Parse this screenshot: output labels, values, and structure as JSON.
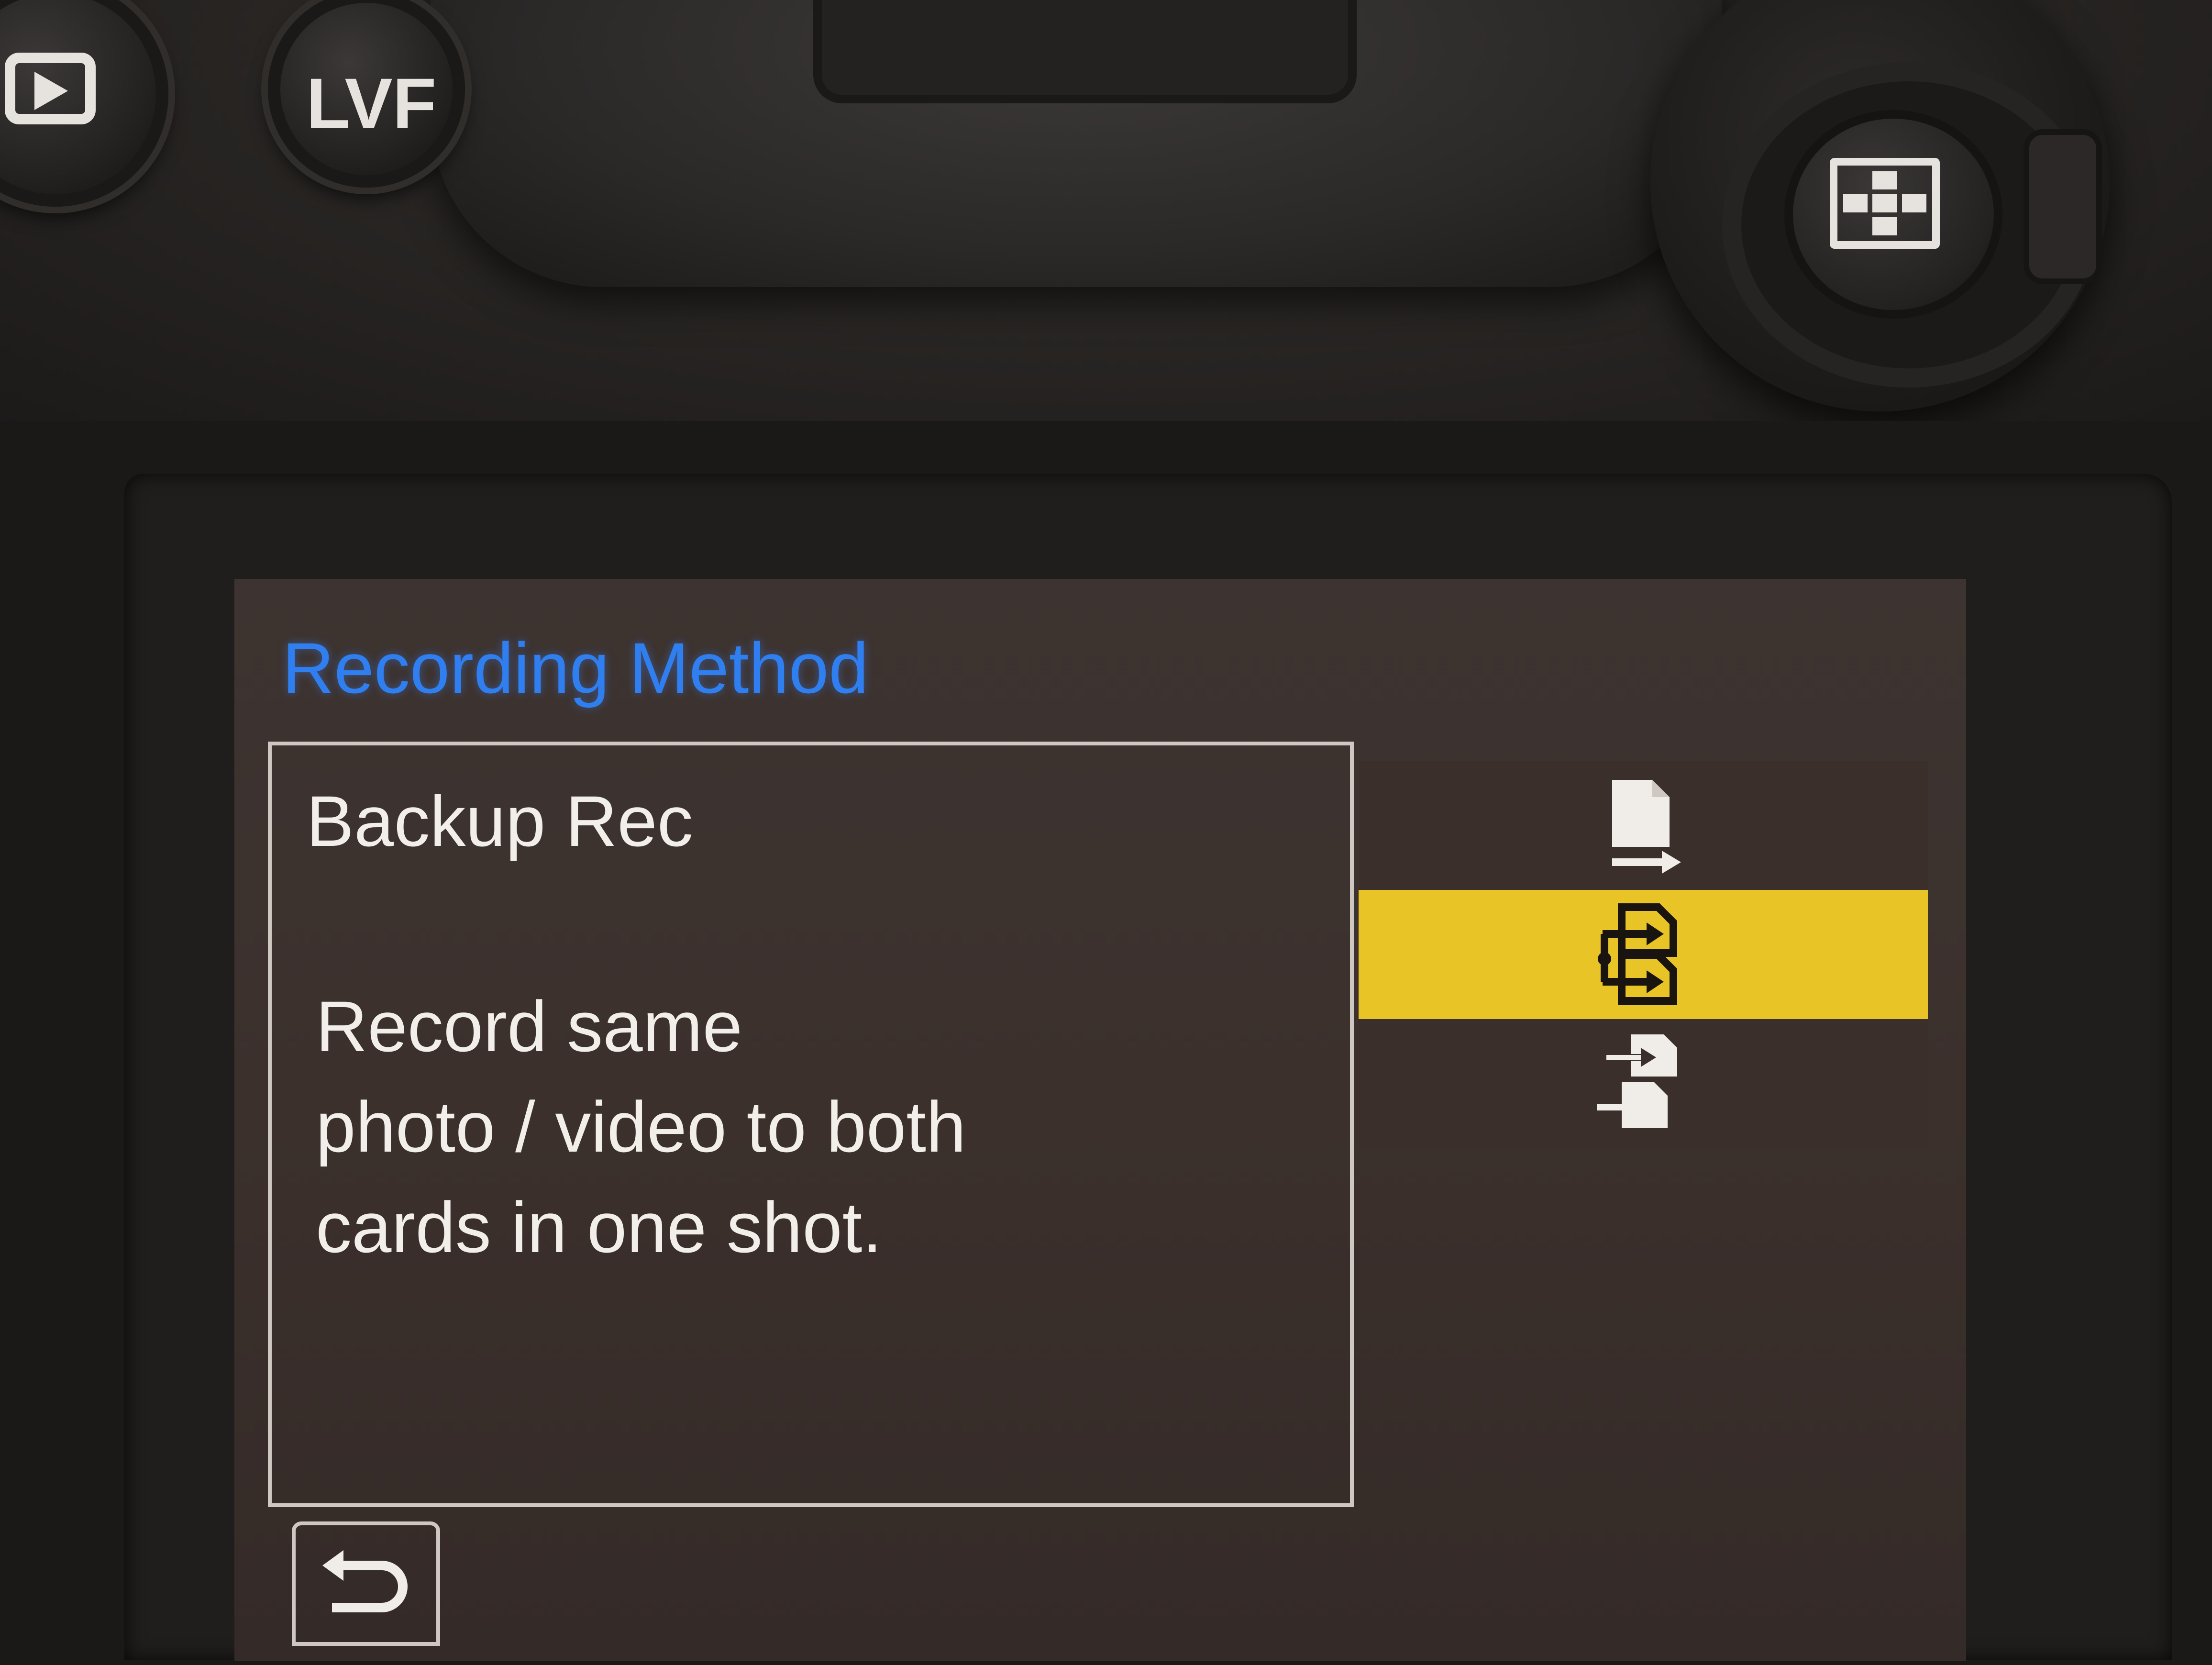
{
  "camera": {
    "buttons": [
      {
        "name": "playback",
        "icon": "play-icon"
      },
      {
        "name": "lvf",
        "label": "LVF"
      },
      {
        "name": "joystick",
        "icon": "af-grid-icon"
      }
    ]
  },
  "screen": {
    "title": "Recording Method",
    "title_color": "#2f7ff0",
    "description": {
      "heading": "Backup Rec",
      "lines": [
        "Record same",
        "photo / video to both",
        "cards in one shot."
      ]
    },
    "options": [
      {
        "name": "relay-rec",
        "icon": "card-arrow-icon",
        "selected": false
      },
      {
        "name": "backup-rec",
        "icon": "double-card-arrow-icon",
        "selected": true
      },
      {
        "name": "allocation-rec",
        "icon": "split-card-arrow-icon",
        "selected": false
      }
    ],
    "selection_color": "#e8c426",
    "back": {
      "icon": "return-icon"
    }
  }
}
